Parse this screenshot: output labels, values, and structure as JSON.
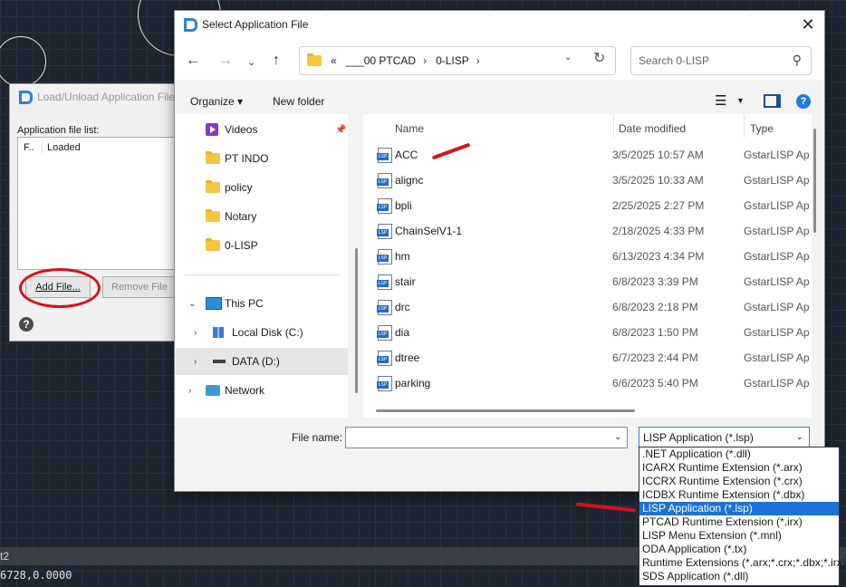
{
  "background_dialog": {
    "title": "Load/Unload Application File",
    "list_label": "Application file list:",
    "col_file": "F..",
    "col_loaded": "Loaded",
    "add_button": "Add File...",
    "remove_button": "Remove File",
    "help_glyph": "?"
  },
  "command_line": {
    "label": "t2",
    "coords": "6728,0.0000"
  },
  "dialog": {
    "title": "Select Application File",
    "close_glyph": "✕",
    "address": {
      "prefix": "«",
      "crumbs": [
        "___00 PTCAD",
        "0-LISP"
      ]
    },
    "search_placeholder": "Search 0-LISP",
    "toolbar": {
      "organize": "Organize ▾",
      "new_folder": "New folder"
    },
    "nav_items": [
      {
        "label": "Videos",
        "icon": "videos-icon",
        "pinned": true
      },
      {
        "label": "PT INDO",
        "icon": "folder-icon"
      },
      {
        "label": "policy",
        "icon": "folder-icon"
      },
      {
        "label": "Notary",
        "icon": "folder-icon"
      },
      {
        "label": "0-LISP",
        "icon": "folder-icon"
      },
      {
        "label": "This PC",
        "icon": "pc-icon",
        "expanded": true
      },
      {
        "label": "Local Disk (C:)",
        "icon": "drive-icon"
      },
      {
        "label": "DATA (D:)",
        "icon": "drive-icon",
        "selected": true
      },
      {
        "label": "Network",
        "icon": "network-icon"
      }
    ],
    "columns": {
      "name": "Name",
      "date": "Date modified",
      "type": "Type"
    },
    "files": [
      {
        "name": "ACC",
        "date": "3/5/2025 10:57 AM",
        "type": "GstarLISP Ap"
      },
      {
        "name": "alignc",
        "date": "3/5/2025 10:33 AM",
        "type": "GstarLISP Ap"
      },
      {
        "name": "bpli",
        "date": "2/25/2025 2:27 PM",
        "type": "GstarLISP Ap"
      },
      {
        "name": "ChainSelV1-1",
        "date": "2/18/2025 4:33 PM",
        "type": "GstarLISP Ap"
      },
      {
        "name": "hm",
        "date": "6/13/2023 4:34 PM",
        "type": "GstarLISP Ap"
      },
      {
        "name": "stair",
        "date": "6/8/2023 3:39 PM",
        "type": "GstarLISP Ap"
      },
      {
        "name": "drc",
        "date": "6/8/2023 2:18 PM",
        "type": "GstarLISP Ap"
      },
      {
        "name": "dia",
        "date": "6/8/2023 1:50 PM",
        "type": "GstarLISP Ap"
      },
      {
        "name": "dtree",
        "date": "6/7/2023 2:44 PM",
        "type": "GstarLISP Ap"
      },
      {
        "name": "parking",
        "date": "6/6/2023 5:40 PM",
        "type": "GstarLISP Ap"
      }
    ],
    "file_name_label": "File name:",
    "file_name_value": "",
    "file_type_selected": "LISP Application (*.lsp)",
    "file_type_options": [
      ".NET Application (*.dll)",
      "ICARX Runtime Extension (*.arx)",
      "ICCRX Runtime Extension (*.crx)",
      "ICDBX Runtime Extension (*.dbx)",
      "LISP Application (*.lsp)",
      "PTCAD Runtime Extension (*.irx)",
      "LISP Menu Extension (*.mnl)",
      "ODA Application (*.tx)",
      "Runtime Extensions (*.arx;*.crx;*.dbx;*.irx)",
      "SDS Application (*.dll)"
    ],
    "selected_option_index": 4
  },
  "colors": {
    "accent": "#1e72d6",
    "annotation": "#d8101a",
    "folder": "#f5c542"
  }
}
